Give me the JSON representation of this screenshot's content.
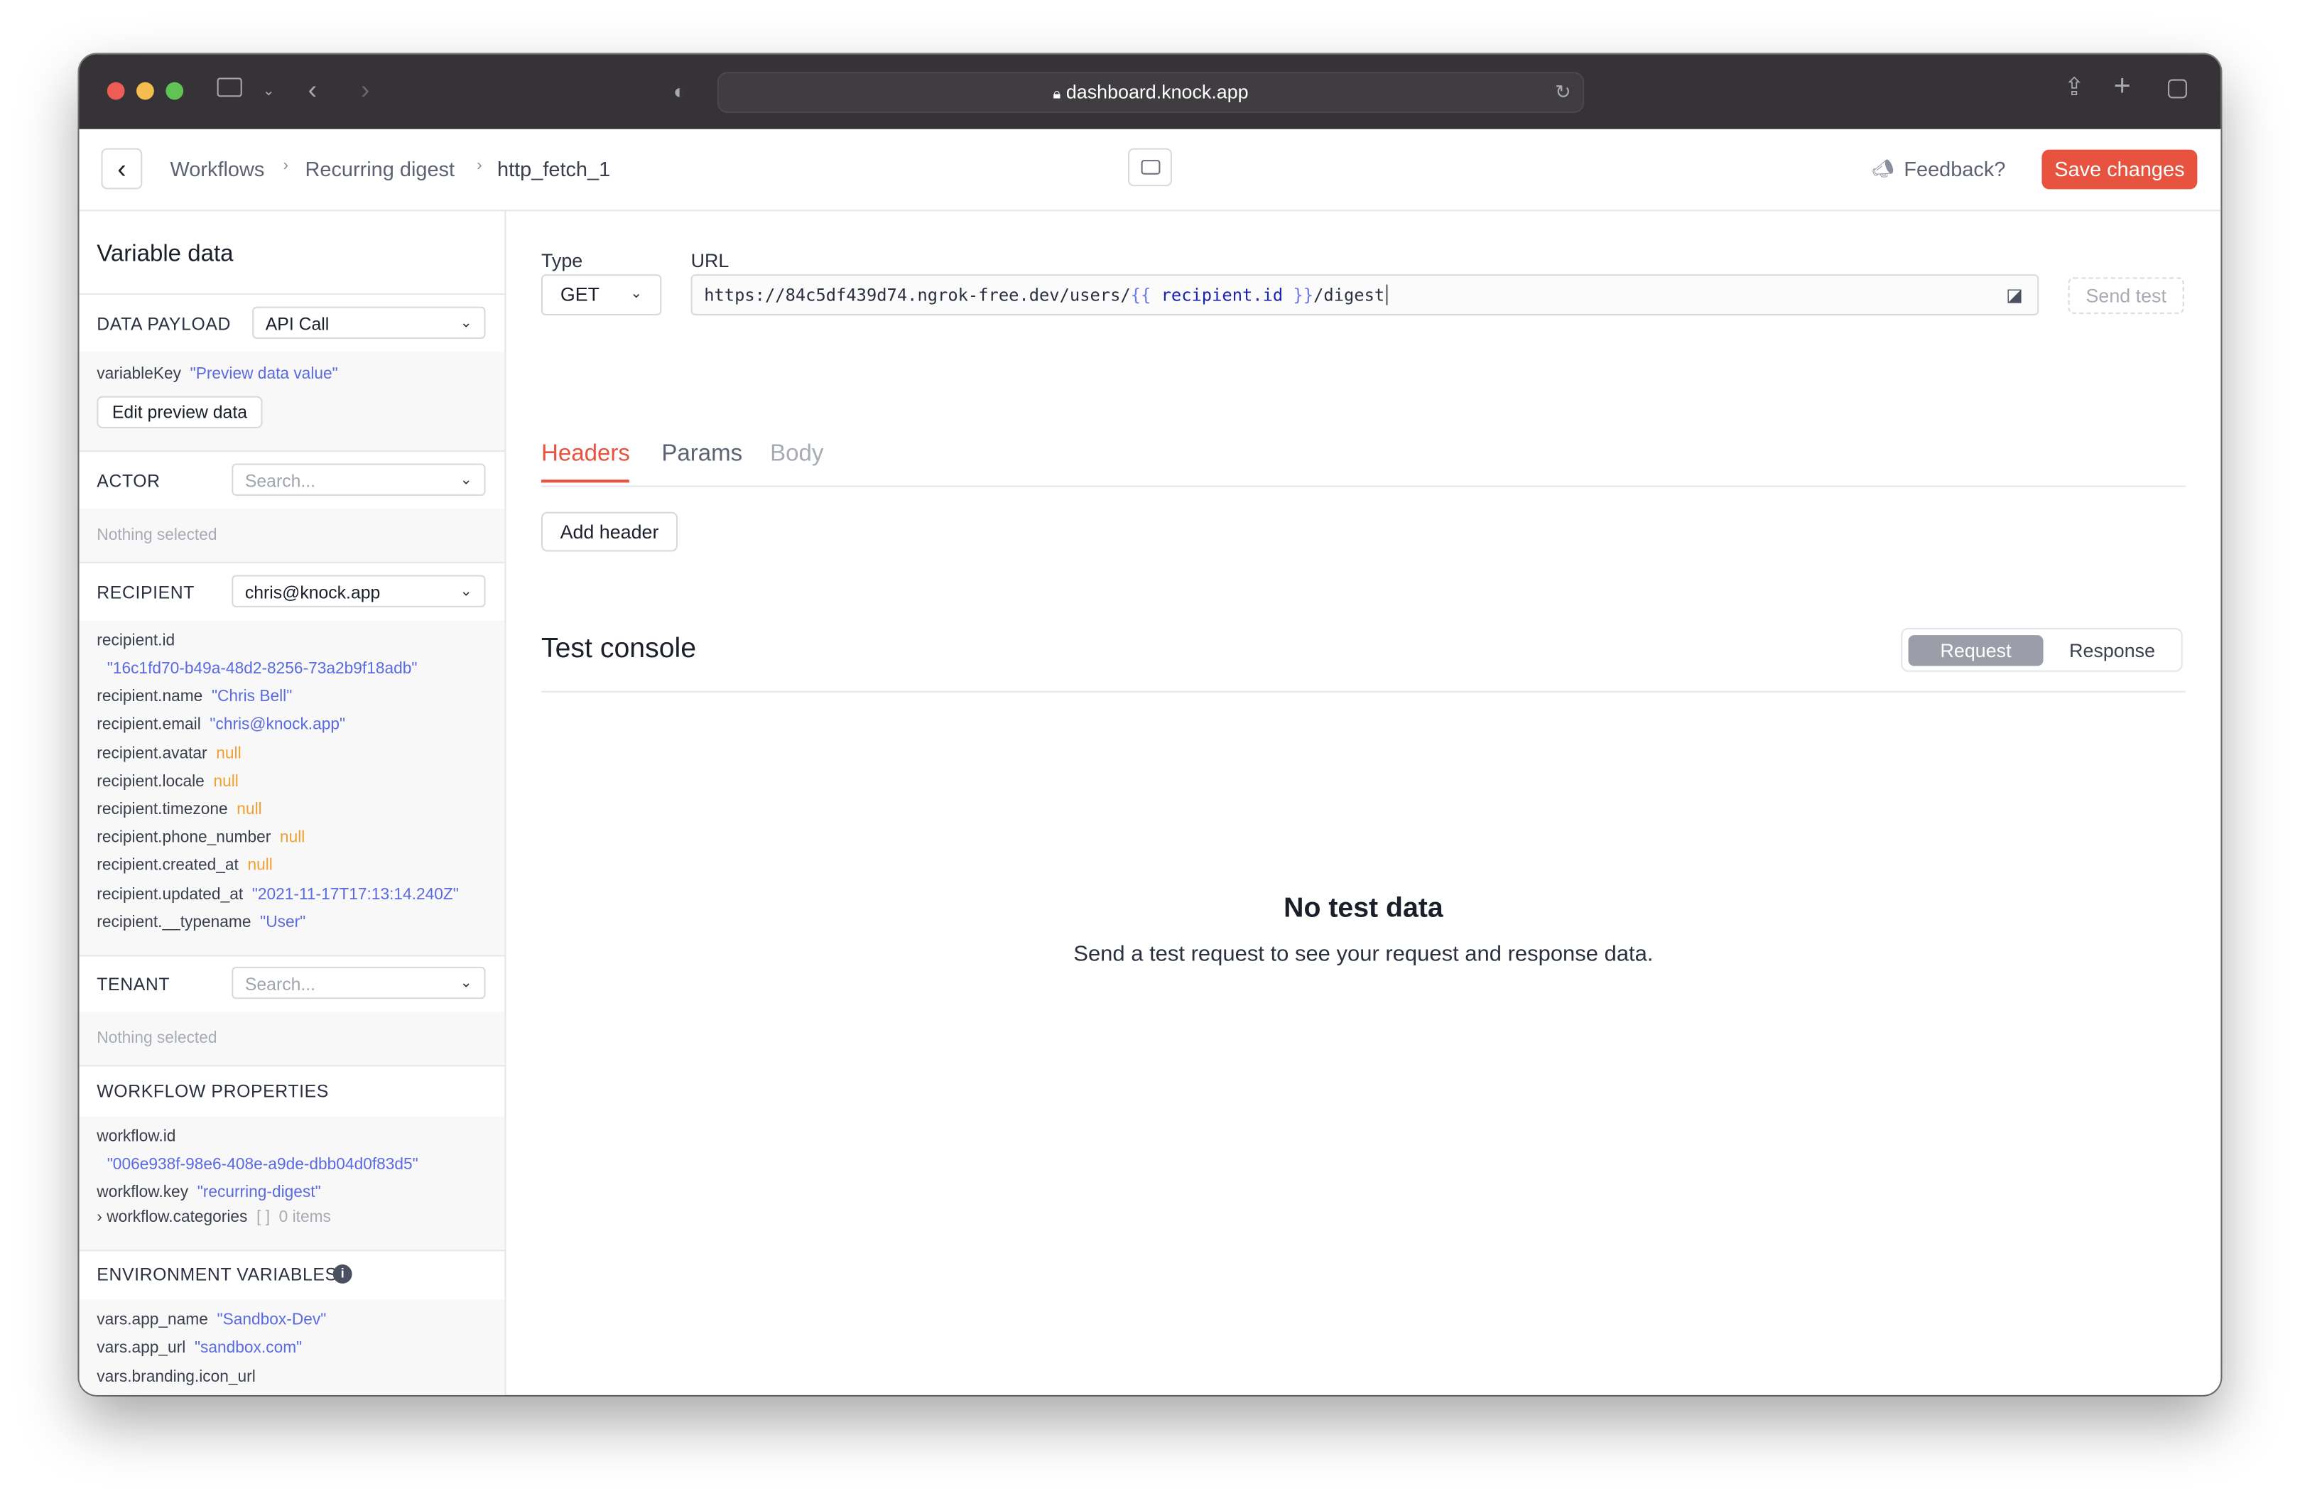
{
  "browser": {
    "url": "dashboard.knock.app",
    "traffic_colors": [
      "#ee5d55",
      "#f5bd4f",
      "#5fc454"
    ]
  },
  "header": {
    "breadcrumbs": [
      "Workflows",
      "Recurring digest",
      "http_fetch_1"
    ],
    "feedback_label": "Feedback?",
    "save_label": "Save changes",
    "accent": "#e8533f"
  },
  "sidebar": {
    "title": "Variable data",
    "data_payload": {
      "label": "DATA PAYLOAD",
      "value": "API Call"
    },
    "variable": {
      "key": "variableKey",
      "value": "\"Preview data value\""
    },
    "edit_preview_label": "Edit preview data",
    "actor": {
      "label": "ACTOR",
      "placeholder": "Search...",
      "empty": "Nothing selected"
    },
    "recipient": {
      "label": "RECIPIENT",
      "value": "chris@knock.app",
      "fields": [
        {
          "key": "recipient.id",
          "value": "\"16c1fd70-b49a-48d2-8256-73a2b9f18adb\"",
          "type": "string"
        },
        {
          "key": "recipient.name",
          "value": "\"Chris Bell\"",
          "type": "string"
        },
        {
          "key": "recipient.email",
          "value": "\"chris@knock.app\"",
          "type": "string"
        },
        {
          "key": "recipient.avatar",
          "value": "null",
          "type": "null"
        },
        {
          "key": "recipient.locale",
          "value": "null",
          "type": "null"
        },
        {
          "key": "recipient.timezone",
          "value": "null",
          "type": "null"
        },
        {
          "key": "recipient.phone_number",
          "value": "null",
          "type": "null"
        },
        {
          "key": "recipient.created_at",
          "value": "null",
          "type": "null"
        },
        {
          "key": "recipient.updated_at",
          "value": "\"2021-11-17T17:13:14.240Z\"",
          "type": "string"
        },
        {
          "key": "recipient.__typename",
          "value": "\"User\"",
          "type": "string"
        }
      ]
    },
    "tenant": {
      "label": "TENANT",
      "placeholder": "Search...",
      "empty": "Nothing selected"
    },
    "workflow": {
      "label": "WORKFLOW PROPERTIES",
      "id_key": "workflow.id",
      "id_value": "\"006e938f-98e6-408e-a9de-dbb04d0f83d5\"",
      "key_key": "workflow.key",
      "key_value": "\"recurring-digest\"",
      "categories_key": "workflow.categories",
      "categories_brackets": "[ ]",
      "categories_count": "0 items"
    },
    "env": {
      "label": "ENVIRONMENT VARIABLES",
      "fields": [
        {
          "key": "vars.app_name",
          "value": "\"Sandbox-Dev\""
        },
        {
          "key": "vars.app_url",
          "value": "\"sandbox.com\""
        },
        {
          "key": "vars.branding.icon_url",
          "value": ""
        }
      ]
    }
  },
  "main": {
    "type_label": "Type",
    "method": "GET",
    "url_label": "URL",
    "url": {
      "prefix": "https://84c5df439d74.ngrok-free.dev/users/",
      "open": "{{",
      "var": " recipient.id ",
      "close": "}}",
      "suffix": "/digest"
    },
    "send_test_label": "Send test",
    "tabs": [
      {
        "label": "Headers",
        "active": true
      },
      {
        "label": "Params",
        "active": false
      },
      {
        "label": "Body",
        "active": false
      }
    ],
    "add_header_label": "Add header",
    "console": {
      "title": "Test console",
      "segments": [
        "Request",
        "Response"
      ],
      "active_segment": "Request",
      "empty_title": "No test data",
      "empty_text": "Send a test request to see your request and response data."
    }
  }
}
